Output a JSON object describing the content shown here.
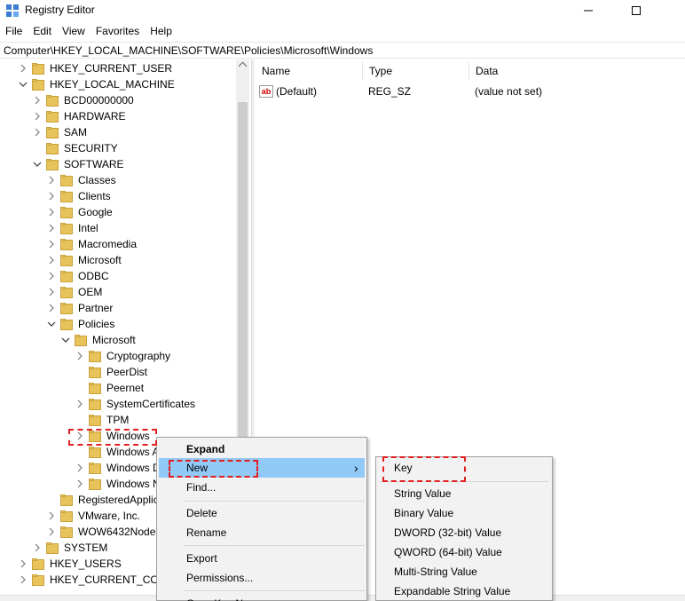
{
  "window": {
    "title": "Registry Editor",
    "minimize_glyph": "—",
    "maximize_glyph": "☐",
    "icon": "registry-icon"
  },
  "menubar": [
    "File",
    "Edit",
    "View",
    "Favorites",
    "Help"
  ],
  "address": "Computer\\HKEY_LOCAL_MACHINE\\SOFTWARE\\Policies\\Microsoft\\Windows",
  "tree": [
    {
      "label": "HKEY_CURRENT_USER",
      "expander": ">"
    },
    {
      "label": "HKEY_LOCAL_MACHINE",
      "expander": "v"
    },
    {
      "label": "BCD00000000",
      "expander": ">"
    },
    {
      "label": "HARDWARE",
      "expander": ">"
    },
    {
      "label": "SAM",
      "expander": ">"
    },
    {
      "label": "SECURITY",
      "expander": ""
    },
    {
      "label": "SOFTWARE",
      "expander": "v"
    },
    {
      "label": "Classes",
      "expander": ">"
    },
    {
      "label": "Clients",
      "expander": ">"
    },
    {
      "label": "Google",
      "expander": ">"
    },
    {
      "label": "Intel",
      "expander": ">"
    },
    {
      "label": "Macromedia",
      "expander": ">"
    },
    {
      "label": "Microsoft",
      "expander": ">"
    },
    {
      "label": "ODBC",
      "expander": ">"
    },
    {
      "label": "OEM",
      "expander": ">"
    },
    {
      "label": "Partner",
      "expander": ">"
    },
    {
      "label": "Policies",
      "expander": "v"
    },
    {
      "label": "Microsoft",
      "expander": "v"
    },
    {
      "label": "Cryptography",
      "expander": ">"
    },
    {
      "label": "PeerDist",
      "expander": ""
    },
    {
      "label": "Peernet",
      "expander": ""
    },
    {
      "label": "SystemCertificates",
      "expander": ">"
    },
    {
      "label": "TPM",
      "expander": ""
    },
    {
      "label": "Windows",
      "expander": ">"
    },
    {
      "label": "Windows A",
      "expander": ""
    },
    {
      "label": "Windows D",
      "expander": ">"
    },
    {
      "label": "Windows N",
      "expander": ">"
    },
    {
      "label": "RegisteredApplic",
      "expander": ""
    },
    {
      "label": "VMware, Inc.",
      "expander": ">"
    },
    {
      "label": "WOW6432Node",
      "expander": ">"
    },
    {
      "label": "SYSTEM",
      "expander": ">"
    },
    {
      "label": "HKEY_USERS",
      "expander": ">"
    },
    {
      "label": "HKEY_CURRENT_CONF",
      "expander": ">"
    }
  ],
  "list": {
    "columns": [
      "Name",
      "Type",
      "Data"
    ],
    "rows": [
      {
        "name": "(Default)",
        "type": "REG_SZ",
        "data": "(value not set)",
        "icon": "ab"
      }
    ]
  },
  "context_menu": {
    "items": [
      "Expand",
      "New",
      "Find...",
      "Delete",
      "Rename",
      "Export",
      "Permissions...",
      "Copy Key Name"
    ],
    "submenu_arrow": "›"
  },
  "new_submenu": {
    "items": [
      "Key",
      "String Value",
      "Binary Value",
      "DWORD (32-bit) Value",
      "QWORD (64-bit) Value",
      "Multi-String Value",
      "Expandable String Value"
    ]
  },
  "colors": {
    "folder": "#e8c35a",
    "highlight": "#91c9f7",
    "annotation": "#e02020"
  }
}
